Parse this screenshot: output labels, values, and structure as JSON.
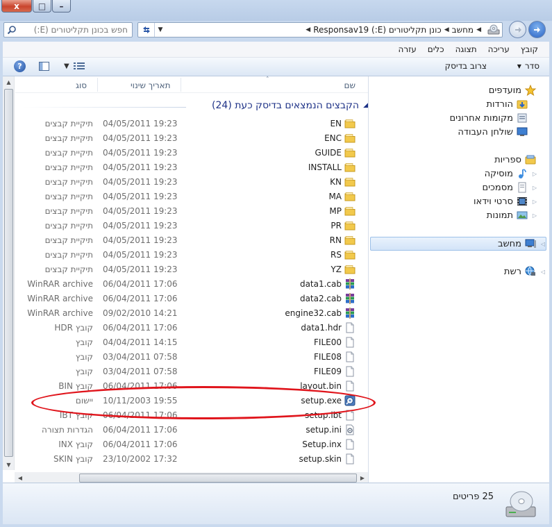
{
  "window": {
    "close_glyph": "x",
    "max_glyph": "□",
    "min_glyph": "–"
  },
  "search": {
    "placeholder": "חפש בכונן תקליטורים (E:)"
  },
  "address": {
    "crumbs": [
      "מחשב",
      "כונן תקליטורים (E:) Responsav19"
    ]
  },
  "menu": [
    "קובץ",
    "עריכה",
    "תצוגה",
    "כלים",
    "עזרה"
  ],
  "toolbar": {
    "organize": "סדר",
    "burn": "צרוב בדיסק"
  },
  "columns": {
    "name": "שם",
    "date": "תאריך שינוי",
    "type": "סוג"
  },
  "group_title": "הקבצים הנמצאים בדיסק כעת (24)",
  "files": [
    {
      "name": "EN",
      "date": "04/05/2011 19:23",
      "type": "תיקיית קבצים",
      "icon": "folder-icon"
    },
    {
      "name": "ENC",
      "date": "04/05/2011 19:23",
      "type": "תיקיית קבצים",
      "icon": "folder-icon"
    },
    {
      "name": "GUIDE",
      "date": "04/05/2011 19:23",
      "type": "תיקיית קבצים",
      "icon": "folder-icon"
    },
    {
      "name": "INSTALL",
      "date": "04/05/2011 19:23",
      "type": "תיקיית קבצים",
      "icon": "folder-icon"
    },
    {
      "name": "KN",
      "date": "04/05/2011 19:23",
      "type": "תיקיית קבצים",
      "icon": "folder-icon"
    },
    {
      "name": "MA",
      "date": "04/05/2011 19:23",
      "type": "תיקיית קבצים",
      "icon": "folder-icon"
    },
    {
      "name": "MP",
      "date": "04/05/2011 19:23",
      "type": "תיקיית קבצים",
      "icon": "folder-icon"
    },
    {
      "name": "PR",
      "date": "04/05/2011 19:23",
      "type": "תיקיית קבצים",
      "icon": "folder-icon"
    },
    {
      "name": "RN",
      "date": "04/05/2011 19:23",
      "type": "תיקיית קבצים",
      "icon": "folder-icon"
    },
    {
      "name": "RS",
      "date": "04/05/2011 19:23",
      "type": "תיקיית קבצים",
      "icon": "folder-icon"
    },
    {
      "name": "YZ",
      "date": "04/05/2011 19:23",
      "type": "תיקיית קבצים",
      "icon": "folder-icon"
    },
    {
      "name": "data1.cab",
      "date": "06/04/2011 17:06",
      "type": "WinRAR archive",
      "icon": "winrar-icon"
    },
    {
      "name": "data2.cab",
      "date": "06/04/2011 17:06",
      "type": "WinRAR archive",
      "icon": "winrar-icon"
    },
    {
      "name": "engine32.cab",
      "date": "09/02/2010 14:21",
      "type": "WinRAR archive",
      "icon": "winrar-icon"
    },
    {
      "name": "data1.hdr",
      "date": "06/04/2011 17:06",
      "type": "קובץ HDR",
      "icon": "file-icon"
    },
    {
      "name": "FILE00",
      "date": "04/04/2011 14:15",
      "type": "קובץ",
      "icon": "file-icon"
    },
    {
      "name": "FILE08",
      "date": "03/04/2011 07:58",
      "type": "קובץ",
      "icon": "file-icon"
    },
    {
      "name": "FILE09",
      "date": "03/04/2011 07:58",
      "type": "קובץ",
      "icon": "file-icon"
    },
    {
      "name": "layout.bin",
      "date": "06/04/2011 17:06",
      "type": "קובץ BIN",
      "icon": "file-icon"
    },
    {
      "name": "setup.exe",
      "date": "10/11/2003 19:55",
      "type": "יישום",
      "icon": "setup-exe-icon"
    },
    {
      "name": "setup.ibt",
      "date": "06/04/2011 17:06",
      "type": "קובץ IBT",
      "icon": "file-icon"
    },
    {
      "name": "setup.ini",
      "date": "06/04/2011 17:06",
      "type": "הגדרות תצורה",
      "icon": "ini-file-icon"
    },
    {
      "name": "Setup.inx",
      "date": "06/04/2011 17:06",
      "type": "קובץ INX",
      "icon": "file-icon"
    },
    {
      "name": "setup.skin",
      "date": "23/10/2002 17:32",
      "type": "קובץ SKIN",
      "icon": "file-icon"
    }
  ],
  "nav": {
    "favorites": "מועדפים",
    "downloads": "הורדות",
    "recent": "מקומות אחרונים",
    "desktop": "שולחן העבודה",
    "libraries": "ספריות",
    "music": "מוסיקה",
    "documents": "מסמכים",
    "videos": "סרטי וידאו",
    "pictures": "תמונות",
    "computer": "מחשב",
    "network": "רשת"
  },
  "status": {
    "count": "25 פריטים"
  },
  "colors": {
    "group_header": "#1e3287",
    "annotation": "#e0151c",
    "folder": "#f2c94c"
  }
}
